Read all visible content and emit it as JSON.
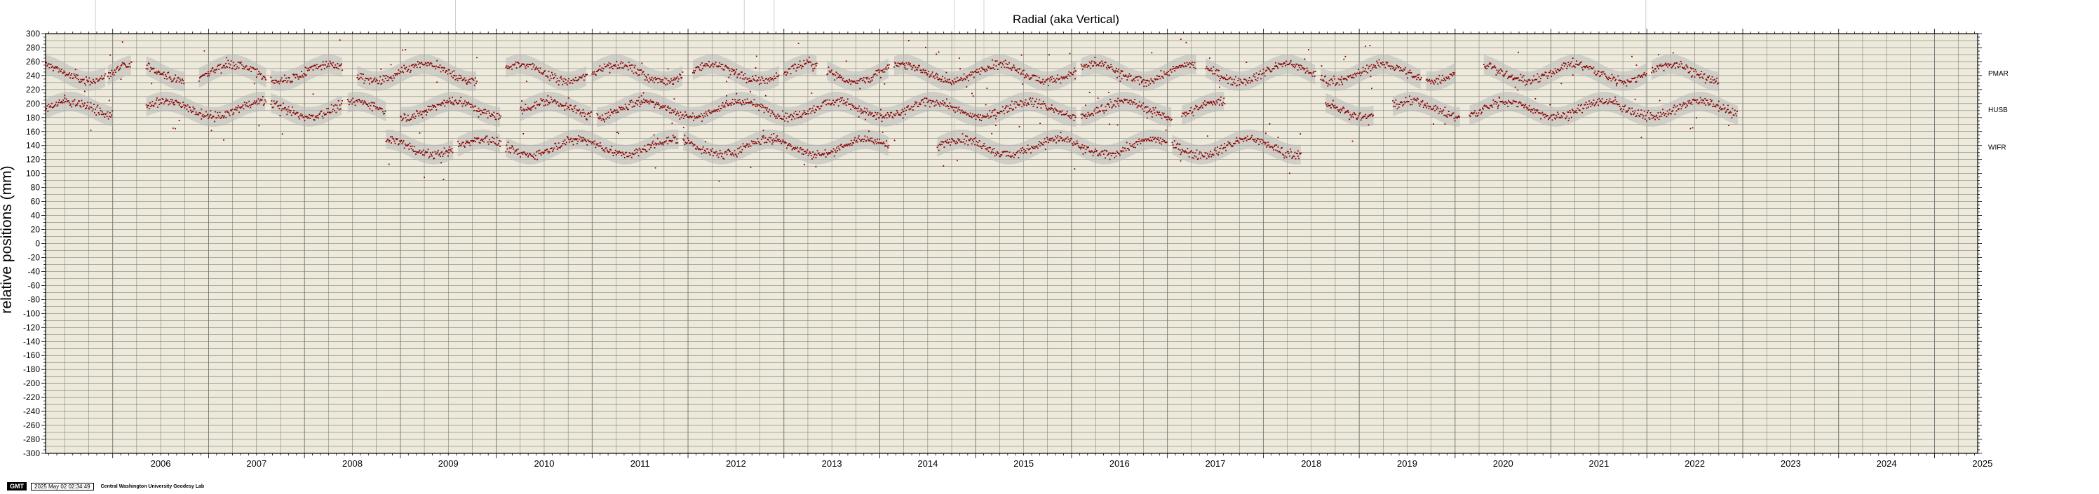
{
  "chart_data": {
    "type": "scatter",
    "title": "Radial (aka Vertical)",
    "ylabel": "relative positions (mm)",
    "xlabel": "",
    "ylim": [
      -300,
      300
    ],
    "xlim": [
      2005.3,
      2025.45
    ],
    "y_ticks": [
      300,
      280,
      260,
      240,
      220,
      200,
      180,
      160,
      140,
      120,
      100,
      80,
      60,
      40,
      20,
      0,
      -20,
      -40,
      -60,
      -80,
      -100,
      -120,
      -140,
      -160,
      -180,
      -200,
      -220,
      -240,
      -260,
      -280,
      -300
    ],
    "x_tick_labels": [
      "2006",
      "2007",
      "2008",
      "2009",
      "2010",
      "2011",
      "2012",
      "2013",
      "2014",
      "2015",
      "2016",
      "2017",
      "2018",
      "2019",
      "2020",
      "2021",
      "2022",
      "2023",
      "2024",
      "2025"
    ],
    "grid": true,
    "series": [
      {
        "name": "PMAR",
        "segments": [
          [
            2005.3,
            2005.93
          ],
          [
            2005.95,
            2006.2
          ],
          [
            2006.35,
            2006.75
          ],
          [
            2006.9,
            2007.6
          ],
          [
            2007.65,
            2008.4
          ],
          [
            2008.55,
            2009.8
          ],
          [
            2010.1,
            2010.95
          ],
          [
            2011.0,
            2011.95
          ],
          [
            2012.05,
            2012.95
          ],
          [
            2013.0,
            2013.35
          ],
          [
            2013.45,
            2014.1
          ],
          [
            2014.15,
            2016.05
          ],
          [
            2016.1,
            2017.3
          ],
          [
            2017.4,
            2018.55
          ],
          [
            2018.6,
            2019.65
          ],
          [
            2019.7,
            2020.0
          ],
          [
            2020.3,
            2022.0
          ],
          [
            2022.05,
            2022.75
          ]
        ],
        "base": 244,
        "trend": 0,
        "amplitude": 12
      },
      {
        "name": "HUSB",
        "segments": [
          [
            2005.3,
            2006.0
          ],
          [
            2006.35,
            2007.6
          ],
          [
            2007.65,
            2008.4
          ],
          [
            2008.45,
            2008.85
          ],
          [
            2009.0,
            2010.05
          ],
          [
            2010.25,
            2011.0
          ],
          [
            2011.05,
            2016.05
          ],
          [
            2016.1,
            2017.05
          ],
          [
            2017.15,
            2017.6
          ],
          [
            2018.65,
            2019.15
          ],
          [
            2019.35,
            2020.05
          ],
          [
            2020.15,
            2022.95
          ]
        ],
        "base": 192,
        "trend": 0,
        "amplitude": 11
      },
      {
        "name": "WIFR",
        "segments": [
          [
            2008.85,
            2009.55
          ],
          [
            2009.6,
            2010.05
          ],
          [
            2010.1,
            2011.9
          ],
          [
            2011.95,
            2014.1
          ],
          [
            2014.6,
            2017.0
          ],
          [
            2017.05,
            2018.4
          ]
        ],
        "base": 138,
        "trend": 0,
        "amplitude": 11
      }
    ],
    "colors": {
      "plot_background": "#eeeadb",
      "grid": "#6e6e6e",
      "points": "#8b0000",
      "uncertainty": "#b8b8b8",
      "spikes": "#bdbdbd"
    }
  },
  "footer": {
    "badge": "GMT",
    "timestamp": "2025 May 02 02:34:49",
    "org": "Central Washington University Geodesy Lab"
  }
}
